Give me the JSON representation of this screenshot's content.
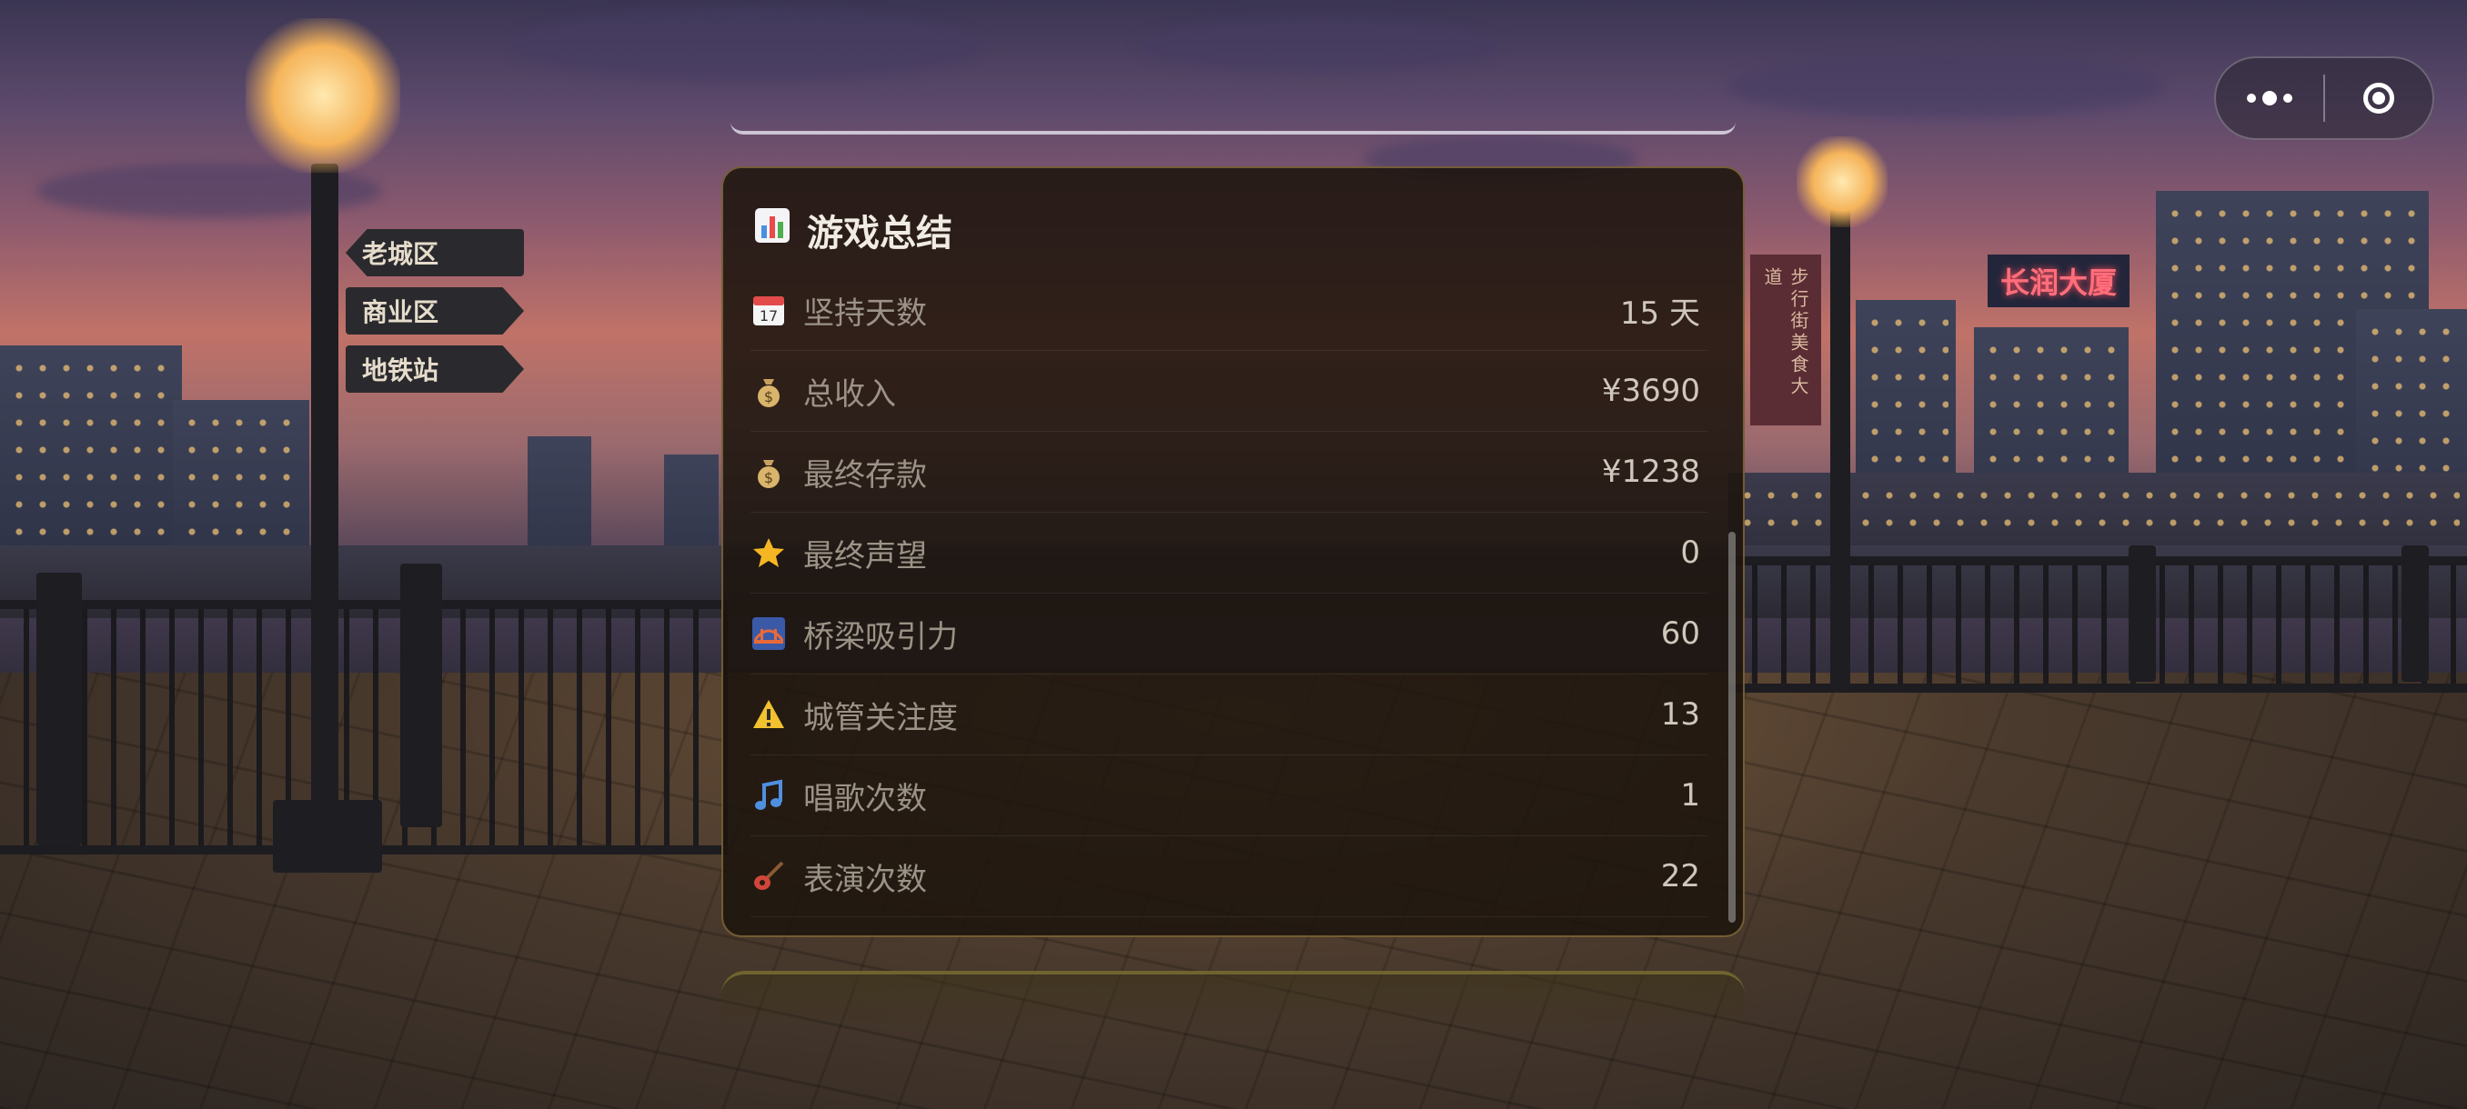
{
  "background": {
    "signs": [
      "老城区",
      "商业区",
      "地铁站"
    ],
    "neon_sign": "长润大厦",
    "banner": "步行街美食大道"
  },
  "capsule": {
    "more_icon": "more-dots-icon",
    "close_icon": "target-circle-icon"
  },
  "summary": {
    "title_icon": "bar-chart-icon",
    "title": "游戏总结",
    "rows": [
      {
        "icon": "calendar-icon",
        "label": "坚持天数",
        "value": "15 天"
      },
      {
        "icon": "money-bag-icon",
        "label": "总收入",
        "value": "¥3690"
      },
      {
        "icon": "money-bag-icon",
        "label": "最终存款",
        "value": "¥1238"
      },
      {
        "icon": "star-icon",
        "label": "最终声望",
        "value": "0"
      },
      {
        "icon": "bridge-icon",
        "label": "桥梁吸引力",
        "value": "60"
      },
      {
        "icon": "warning-icon",
        "label": "城管关注度",
        "value": "13"
      },
      {
        "icon": "music-note-icon",
        "label": "唱歌次数",
        "value": "1"
      },
      {
        "icon": "guitar-icon",
        "label": "表演次数",
        "value": "22"
      }
    ]
  }
}
